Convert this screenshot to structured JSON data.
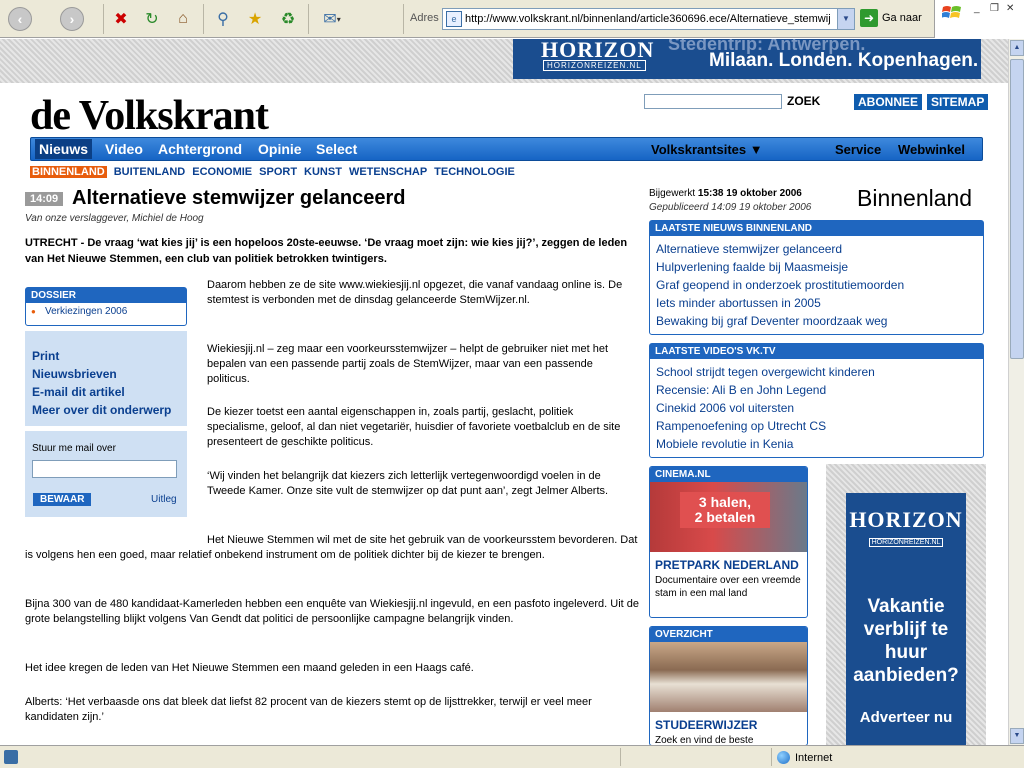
{
  "browser": {
    "address_label": "Adres",
    "url": "http://www.volkskrant.nl/binnenland/article360696.ece/Alternatieve_stemwij",
    "go_label": "Ga naar"
  },
  "banner_top": {
    "brand": "HORIZON",
    "brand_sub": "HORIZONREIZEN.NL",
    "ghost_text": "Stedentrip: Antwerpen.",
    "cities": "Milaan. Londen. Kopenhagen."
  },
  "site": {
    "logo": "de Volkskrant",
    "search_button": "ZOEK",
    "abonnee": "ABONNEE",
    "sitemap": "SITEMAP"
  },
  "nav": {
    "items": [
      "Nieuws",
      "Video",
      "Achtergrond",
      "Opinie",
      "Select"
    ],
    "volkskrantsites": "Volkskrantsites",
    "service": "Service",
    "webwinkel": "Webwinkel"
  },
  "subnav": [
    "BINNENLAND",
    "BUITENLAND",
    "ECONOMIE",
    "SPORT",
    "KUNST",
    "WETENSCHAP",
    "TECHNOLOGIE"
  ],
  "article": {
    "time": "14:09",
    "title": "Alternatieve stemwijzer gelanceerd",
    "byline": "Van onze verslaggever, Michiel de Hoog",
    "intro": "UTRECHT - De vraag ‘wat kies jij’ is een hopeloos 20ste-eeuwse. ‘De vraag moet zijn: wie kies jij?’, zeggen de leden van Het Nieuwe Stemmen, een club van politiek betrokken twintigers.",
    "paragraphs": [
      "Daarom hebben ze de site www.wiekiesjij.nl opgezet, die vanaf vandaag online is. De stemtest is verbonden met de dinsdag gelanceerde StemWijzer.nl.",
      "Wiekiesjij.nl – zeg maar een voorkeursstemwijzer – helpt de gebruiker niet met het bepalen van een passende partij zoals de StemWijzer, maar van een passende politicus.",
      "De kiezer toetst een aantal eigenschappen in, zoals partij, geslacht, politiek specialisme, geloof, al dan niet vegetariër, huisdier of favoriete voetbalclub en de site presenteert de geschikte politicus.",
      "‘Wij vinden het belangrijk dat kiezers zich letterlijk vertegenwoordigd voelen in de Tweede Kamer. Onze site vult de stemwijzer op dat punt aan’, zegt Jelmer Alberts.",
      "Het Nieuwe Stemmen wil met de site het gebruik van de voorkeursstem bevorderen. Dat is volgens hen een goed, maar relatief onbekend instrument om de politiek dichter bij de kiezer te brengen.",
      "Bijna 300 van de 480 kandidaat-Kamerleden hebben een enquête van Wiekiesjij.nl ingevuld, en een pasfoto ingeleverd. Uit de grote belangstelling blijkt volgens Van Gendt dat politici de persoonlijke campagne belangrijk vinden.",
      "Het idee kregen de leden van Het Nieuwe Stemmen een maand geleden in een Haags café.",
      "Alberts: ‘Het verbaasde ons dat bleek dat liefst 82 procent van de kiezers stemt op de lijsttrekker, terwijl er veel meer kandidaten zijn.’"
    ]
  },
  "dossier": {
    "header": "DOSSIER",
    "item": "Verkiezingen 2006"
  },
  "tools": [
    "Print",
    "Nieuwsbrieven",
    "E-mail dit artikel",
    "Meer over dit onderwerp"
  ],
  "mail": {
    "label": "Stuur me mail over",
    "button": "BEWAAR",
    "help": "Uitleg"
  },
  "meta": {
    "updated_label": "Bijgewerkt",
    "updated_value": "15:38 19 oktober 2006",
    "published": "Gepubliceerd 14:09 19 oktober 2006",
    "section": "Binnenland"
  },
  "latest_news": {
    "header": "LAATSTE NIEUWS BINNENLAND",
    "items": [
      "Alternatieve stemwijzer gelanceerd",
      "Hulpverlening faalde bij Maasmeisje",
      "Graf geopend in onderzoek prostitutiemoorden",
      "Iets minder abortussen in 2005",
      "Bewaking bij graf Deventer moordzaak weg"
    ]
  },
  "latest_videos": {
    "header": "LAATSTE VIDEO'S VK.TV",
    "items": [
      "School strijdt tegen overgewicht kinderen",
      "Recensie: Ali B en John Legend",
      "Cinekid 2006 vol uitersten",
      "Rampenoefening op Utrecht CS",
      "Mobiele revolutie in Kenia"
    ]
  },
  "cinema": {
    "header": "CINEMA.NL",
    "image_text_1": "3 halen,",
    "image_text_2": "2 betalen",
    "title": "PRETPARK NEDERLAND",
    "desc": "Documentaire over een vreemde stam in een mal land"
  },
  "overzicht": {
    "header": "OVERZICHT",
    "title": "STUDEERWIJZER",
    "desc": "Zoek en vind de beste"
  },
  "side_ad": {
    "brand": "HORIZON",
    "brand_sub": "HORIZONREIZEN.NL",
    "text": "Vakantie verblijf te huur aanbieden?",
    "cta": "Adverteer nu"
  },
  "status": {
    "zone": "Internet"
  },
  "colors": {
    "brand_blue": "#1f66bf",
    "nav_blue": "#1664c4",
    "accent_orange": "#e85d0c",
    "link_blue": "#0a3f8f"
  }
}
